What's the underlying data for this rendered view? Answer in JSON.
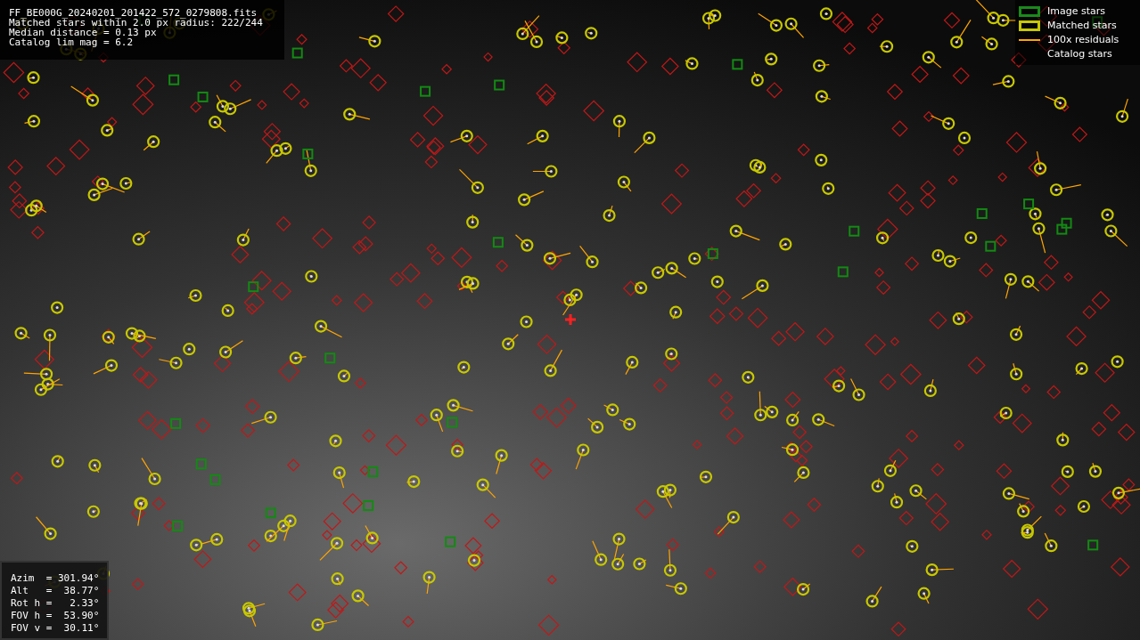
{
  "header_info": [
    "FF_BE000G_20240201_201422_572_0279808.fits",
    "Matched stars within 2.0 px radius: 222/244",
    "Median distance = 0.13 px",
    "Catalog lim mag = 6.2"
  ],
  "legend": [
    {
      "kind": "box",
      "color": "#1a8a1a",
      "label": "Image stars"
    },
    {
      "kind": "box",
      "color": "#c8c800",
      "label": "Matched stars"
    },
    {
      "kind": "line",
      "color": "#ffa500",
      "label": "100x residuals"
    },
    {
      "kind": "none",
      "label": "Catalog stars"
    }
  ],
  "pointing": [
    "Azim  = 301.94°",
    "Alt   =  38.77°",
    "Rot h =   2.33°",
    "FOV h =  53.90°",
    "FOV v =  30.11°"
  ]
}
